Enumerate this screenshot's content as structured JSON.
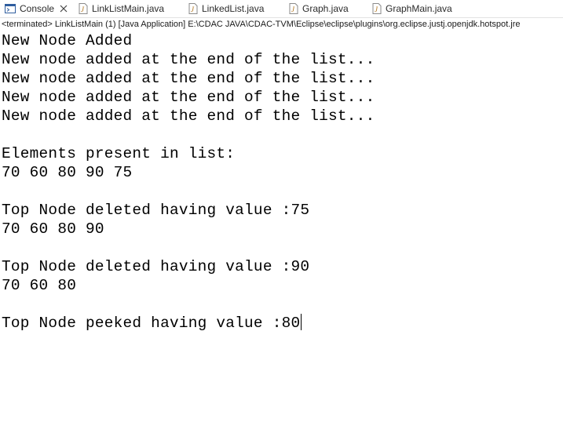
{
  "tabs": [
    {
      "label": "Console",
      "icon": "console-icon",
      "active": true,
      "closable": true
    },
    {
      "label": "LinkListMain.java",
      "icon": "java-file-icon"
    },
    {
      "label": "LinkedList.java",
      "icon": "java-file-icon"
    },
    {
      "label": "Graph.java",
      "icon": "java-file-icon"
    },
    {
      "label": "GraphMain.java",
      "icon": "java-file-icon"
    }
  ],
  "status": "<terminated> LinkListMain (1) [Java Application] E:\\CDAC JAVA\\CDAC-TVM\\Eclipse\\eclipse\\plugins\\org.eclipse.justj.openjdk.hotspot.jre",
  "console": {
    "lines": [
      "New Node Added",
      "New node added at the end of the list...",
      "New node added at the end of the list...",
      "New node added at the end of the list...",
      "New node added at the end of the list...",
      "",
      "Elements present in list:",
      "70 60 80 90 75",
      "",
      "Top Node deleted having value :75",
      "70 60 80 90",
      "",
      "Top Node deleted having value :90",
      "70 60 80",
      "",
      "Top Node peeked having value :80"
    ]
  },
  "colors": {
    "java_icon": "#b07219",
    "console_icon": "#2f5d9e"
  }
}
